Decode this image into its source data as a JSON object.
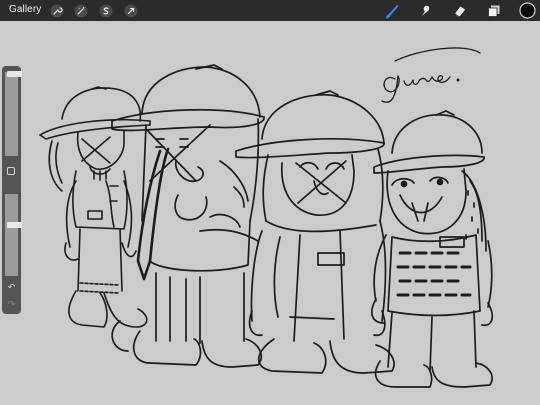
{
  "topbar": {
    "gallery_label": "Gallery",
    "left_tools": [
      {
        "name": "wrench-icon"
      },
      {
        "name": "adjustments-wand-icon"
      },
      {
        "name": "selection-s-icon"
      },
      {
        "name": "transform-arrow-icon"
      }
    ],
    "right_tools": [
      {
        "name": "brush-icon",
        "active": true
      },
      {
        "name": "smudge-icon"
      },
      {
        "name": "eraser-icon"
      },
      {
        "name": "layers-icon"
      },
      {
        "name": "color-swatch"
      }
    ],
    "active_color": "#3b82f6",
    "current_color": "#000000"
  },
  "canvas": {
    "signature_text": "Gune.",
    "background": "#cbcbcb"
  },
  "sidebar": {
    "brush_size_level": 0.35,
    "opacity_level": 0.4
  }
}
